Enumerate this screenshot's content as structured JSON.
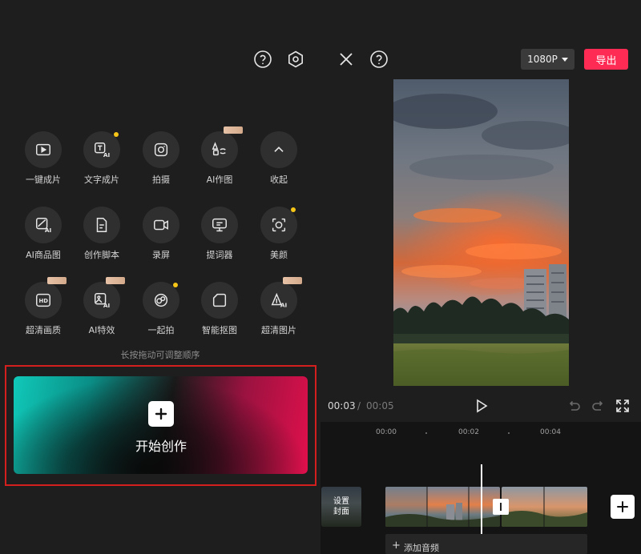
{
  "toolbar": {
    "help_icon": "question-circle-icon",
    "settings_icon": "hexagon-settings-icon",
    "close_icon": "close-icon",
    "help_icon_right": "question-circle-icon"
  },
  "tools": [
    {
      "label": "一键成片",
      "icon": "play-box-icon",
      "badge": ""
    },
    {
      "label": "文字成片",
      "icon": "text-ai-icon",
      "badge": "dot"
    },
    {
      "label": "拍摄",
      "icon": "camera-icon",
      "badge": ""
    },
    {
      "label": "AI作图",
      "icon": "ai-draw-icon",
      "badge": "tag"
    },
    {
      "label": "收起",
      "icon": "chevron-up-icon",
      "badge": ""
    },
    {
      "label": "AI商品图",
      "icon": "ai-product-icon",
      "badge": ""
    },
    {
      "label": "创作脚本",
      "icon": "script-icon",
      "badge": ""
    },
    {
      "label": "录屏",
      "icon": "screen-record-icon",
      "badge": ""
    },
    {
      "label": "提词器",
      "icon": "teleprompter-icon",
      "badge": ""
    },
    {
      "label": "美颜",
      "icon": "beauty-icon",
      "badge": "dot"
    },
    {
      "label": "超清画质",
      "icon": "hd-icon",
      "badge": "tag"
    },
    {
      "label": "AI特效",
      "icon": "ai-effects-icon",
      "badge": "tag"
    },
    {
      "label": "一起拍",
      "icon": "duet-icon",
      "badge": "dot"
    },
    {
      "label": "智能抠图",
      "icon": "cutout-icon",
      "badge": ""
    },
    {
      "label": "超清图片",
      "icon": "ai-image-enhance-icon",
      "badge": "tag"
    }
  ],
  "hint": "长按拖动可调整顺序",
  "create": {
    "label": "开始创作",
    "icon": "plus-icon"
  },
  "export": {
    "resolution": "1080P",
    "export_label": "导出"
  },
  "player": {
    "current_time": "00:03",
    "separator": "/",
    "total_time": "00:05"
  },
  "timeline": {
    "ticks": [
      "00:00",
      "00:02",
      "00:04"
    ],
    "cover_label": "设置\n封面",
    "add_audio_label": "添加音频",
    "add_audio_plus": "+"
  },
  "colors": {
    "accent_export": "#fe2c55",
    "highlight_frame": "#d3201f",
    "badge_dot": "#f5c518"
  }
}
